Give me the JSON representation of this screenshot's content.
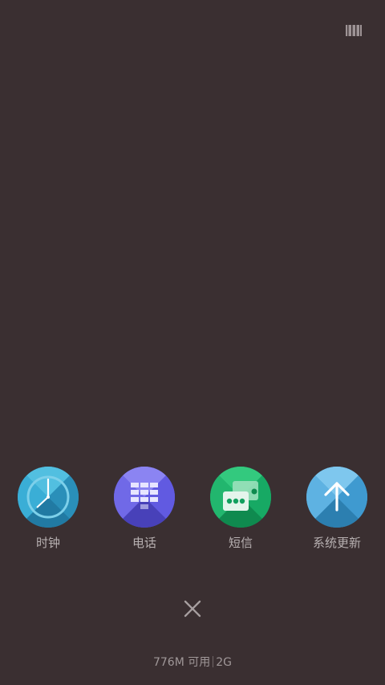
{
  "apps": [
    {
      "label": "时钟",
      "icon": "clock-icon",
      "color": "#2f9ec6"
    },
    {
      "label": "电话",
      "icon": "dialpad-icon",
      "color": "#6a63e2"
    },
    {
      "label": "短信",
      "icon": "message-icon",
      "color": "#19b26b"
    },
    {
      "label": "系统更新",
      "icon": "upload-icon",
      "color": "#4ea7dc"
    }
  ],
  "memory": {
    "available": "776M 可用",
    "total": "2G"
  },
  "top_icon": "task-list-icon",
  "close_icon": "close-icon"
}
